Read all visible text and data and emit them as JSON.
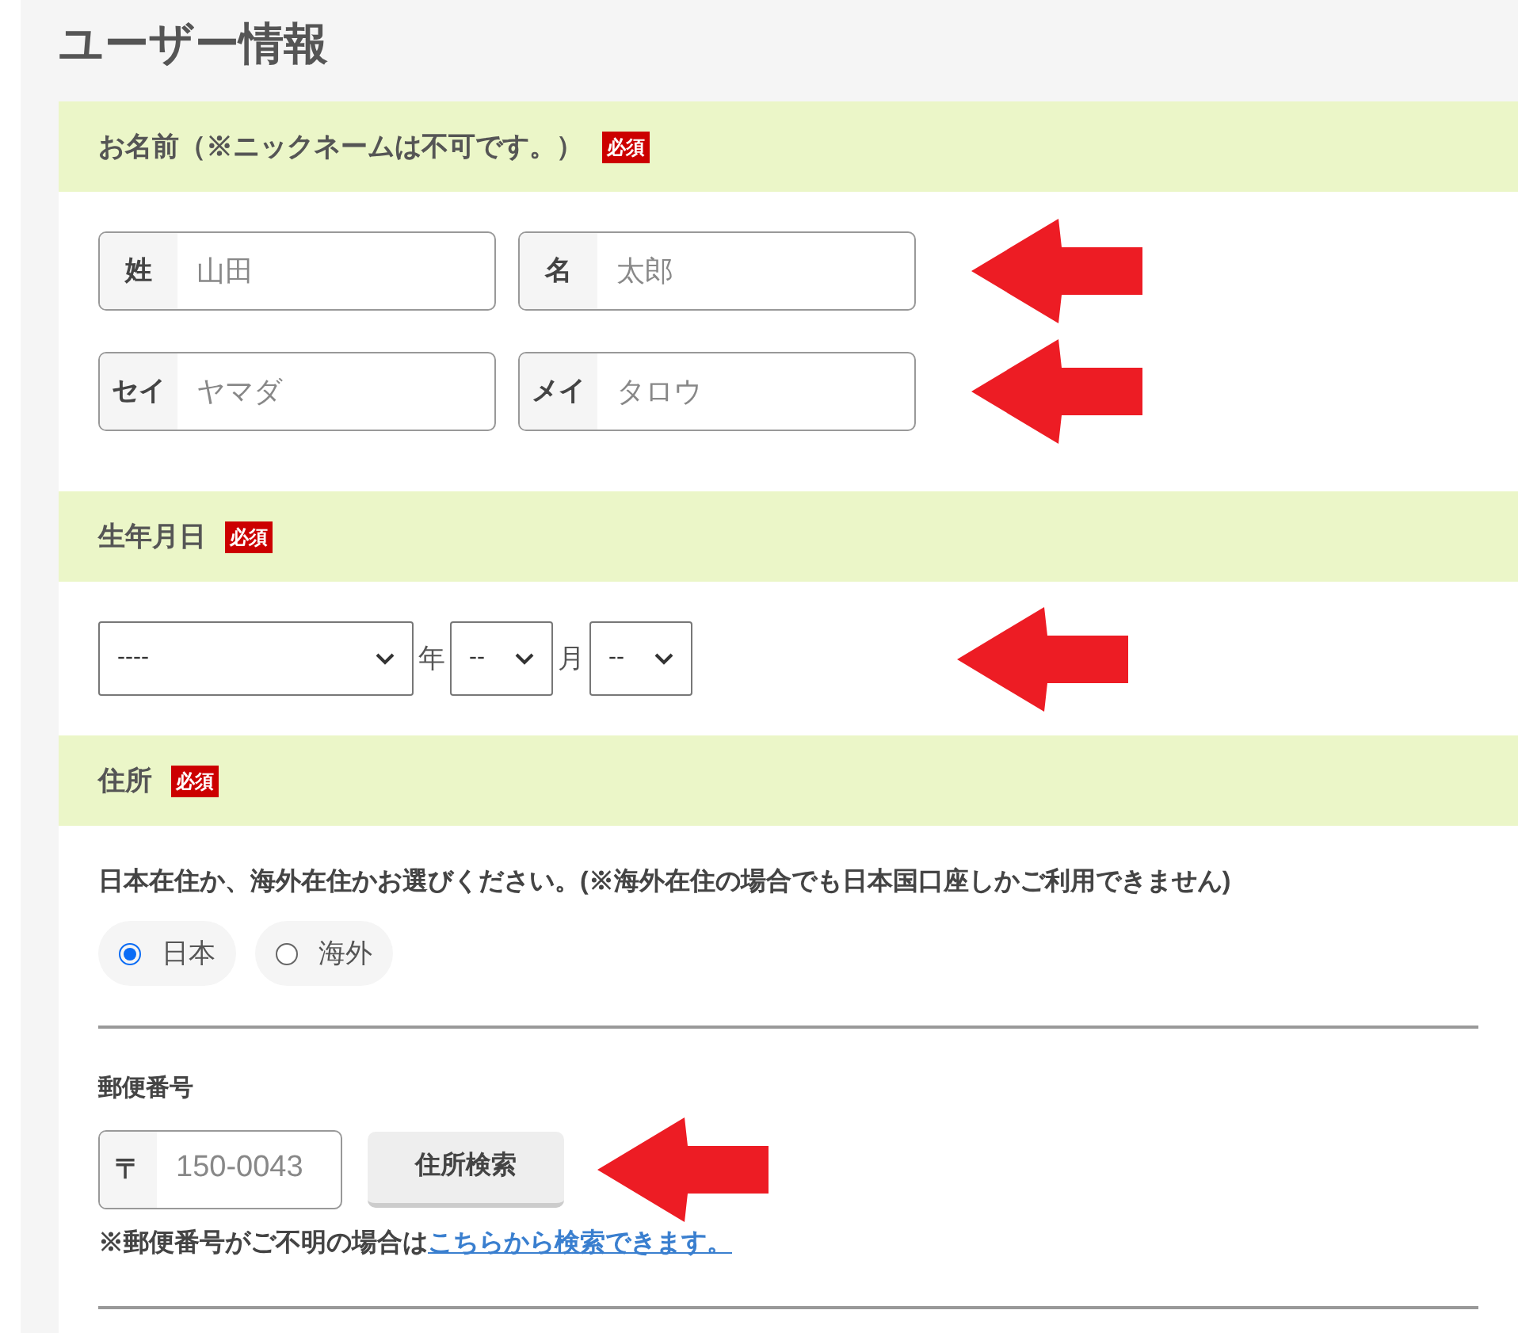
{
  "title": "ユーザー情報",
  "name_section": {
    "heading": "お名前（※ニックネームは不可です。）",
    "badge": "必須",
    "rows": [
      [
        {
          "label": "姓",
          "placeholder": "山田"
        },
        {
          "label": "名",
          "placeholder": "太郎"
        }
      ],
      [
        {
          "label": "セイ",
          "placeholder": "ヤマダ"
        },
        {
          "label": "メイ",
          "placeholder": "タロウ"
        }
      ]
    ]
  },
  "birth_section": {
    "heading": "生年月日",
    "badge": "必須",
    "selects": [
      {
        "value": "----",
        "unit": "年"
      },
      {
        "value": "--",
        "unit": "月"
      },
      {
        "value": "--"
      }
    ]
  },
  "address_section": {
    "heading": "住所",
    "badge": "必須",
    "question": "日本在住か、海外在住かお選びください。(※海外在住の場合でも日本国口座しかご利用できません)",
    "options": [
      {
        "label": "日本",
        "selected": true
      },
      {
        "label": "海外",
        "selected": false
      }
    ],
    "postal_label": "郵便番号",
    "postal_prefix": "〒",
    "postal_placeholder": "150-0043",
    "search_button": "住所検索",
    "note": "※郵便番号がご不明の場合は",
    "note_link": "こちらから検索できます。"
  }
}
